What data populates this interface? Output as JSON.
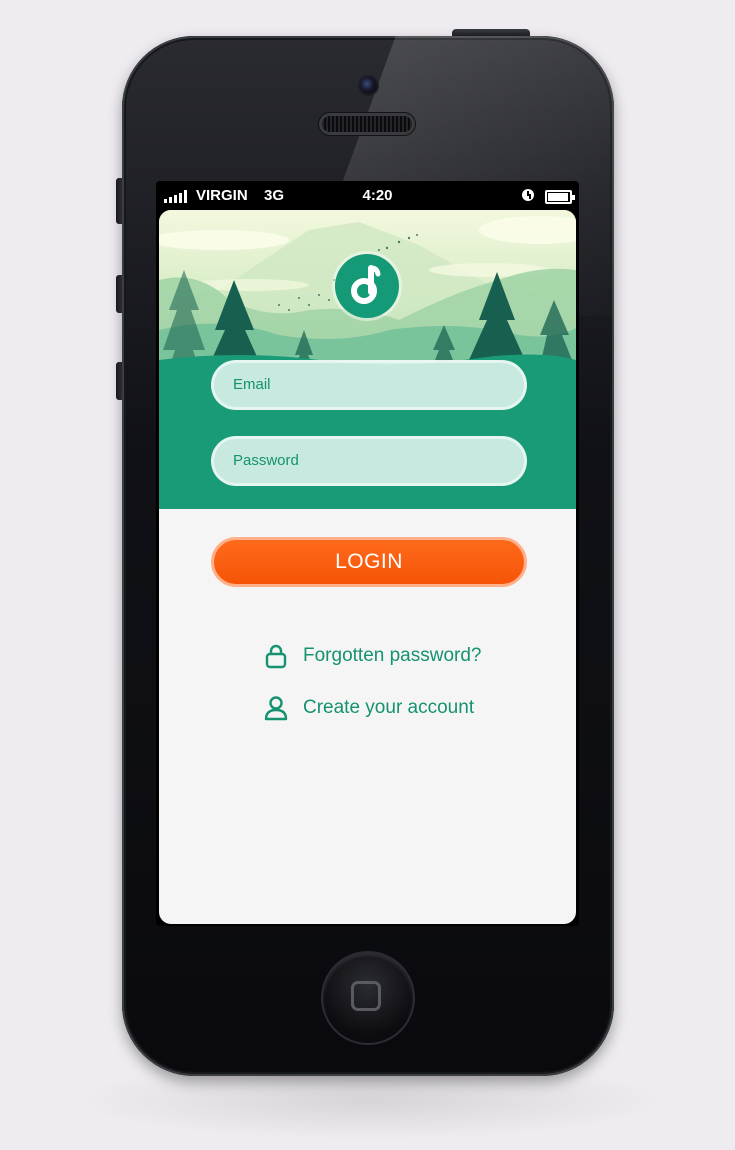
{
  "status_bar": {
    "carrier": "VIRGIN",
    "network": "3G",
    "time": "4:20"
  },
  "login_form": {
    "email_placeholder": "Email",
    "password_placeholder": "Password",
    "login_label": "LOGIN"
  },
  "links": {
    "forgot_password": "Forgotten password?",
    "create_account": "Create your account"
  },
  "icons": {
    "logo": "music-note-icon",
    "forgot": "lock-icon",
    "create": "user-icon"
  },
  "colors": {
    "accent_green": "#149a76",
    "login_orange": "#f55406",
    "link_text": "#159271"
  }
}
